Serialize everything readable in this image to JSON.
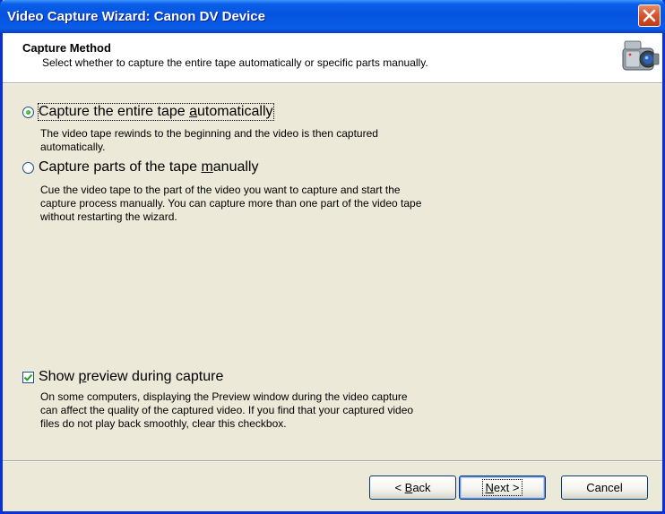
{
  "window": {
    "title": "Video Capture Wizard: Canon DV Device"
  },
  "header": {
    "title": "Capture Method",
    "subtitle": "Select whether to capture the entire tape automatically or specific parts manually.",
    "icon": "camcorder-icon"
  },
  "options": {
    "auto": {
      "label_pre": "Capture the entire tape ",
      "label_accel": "a",
      "label_post": "utomatically",
      "description": "The video tape rewinds to the beginning and the video is then captured automatically.",
      "selected": true
    },
    "manual": {
      "label_pre": "Capture parts of the tape ",
      "label_accel": "m",
      "label_post": "anually",
      "description": "Cue the video tape to the part of the video you want to capture and start the capture process manually. You can capture more than one part of the video tape without restarting the wizard.",
      "selected": false
    }
  },
  "preview": {
    "label_pre": "Show ",
    "label_accel": "p",
    "label_post": "review during capture",
    "description": "On some computers, displaying the Preview window during the video capture can affect the quality of the captured video. If you find that your captured video files do not play back smoothly, clear this checkbox.",
    "checked": true
  },
  "buttons": {
    "back_prefix": "< ",
    "back_accel": "B",
    "back_rest": "ack",
    "next_accel": "N",
    "next_rest": "ext >",
    "cancel": "Cancel"
  }
}
